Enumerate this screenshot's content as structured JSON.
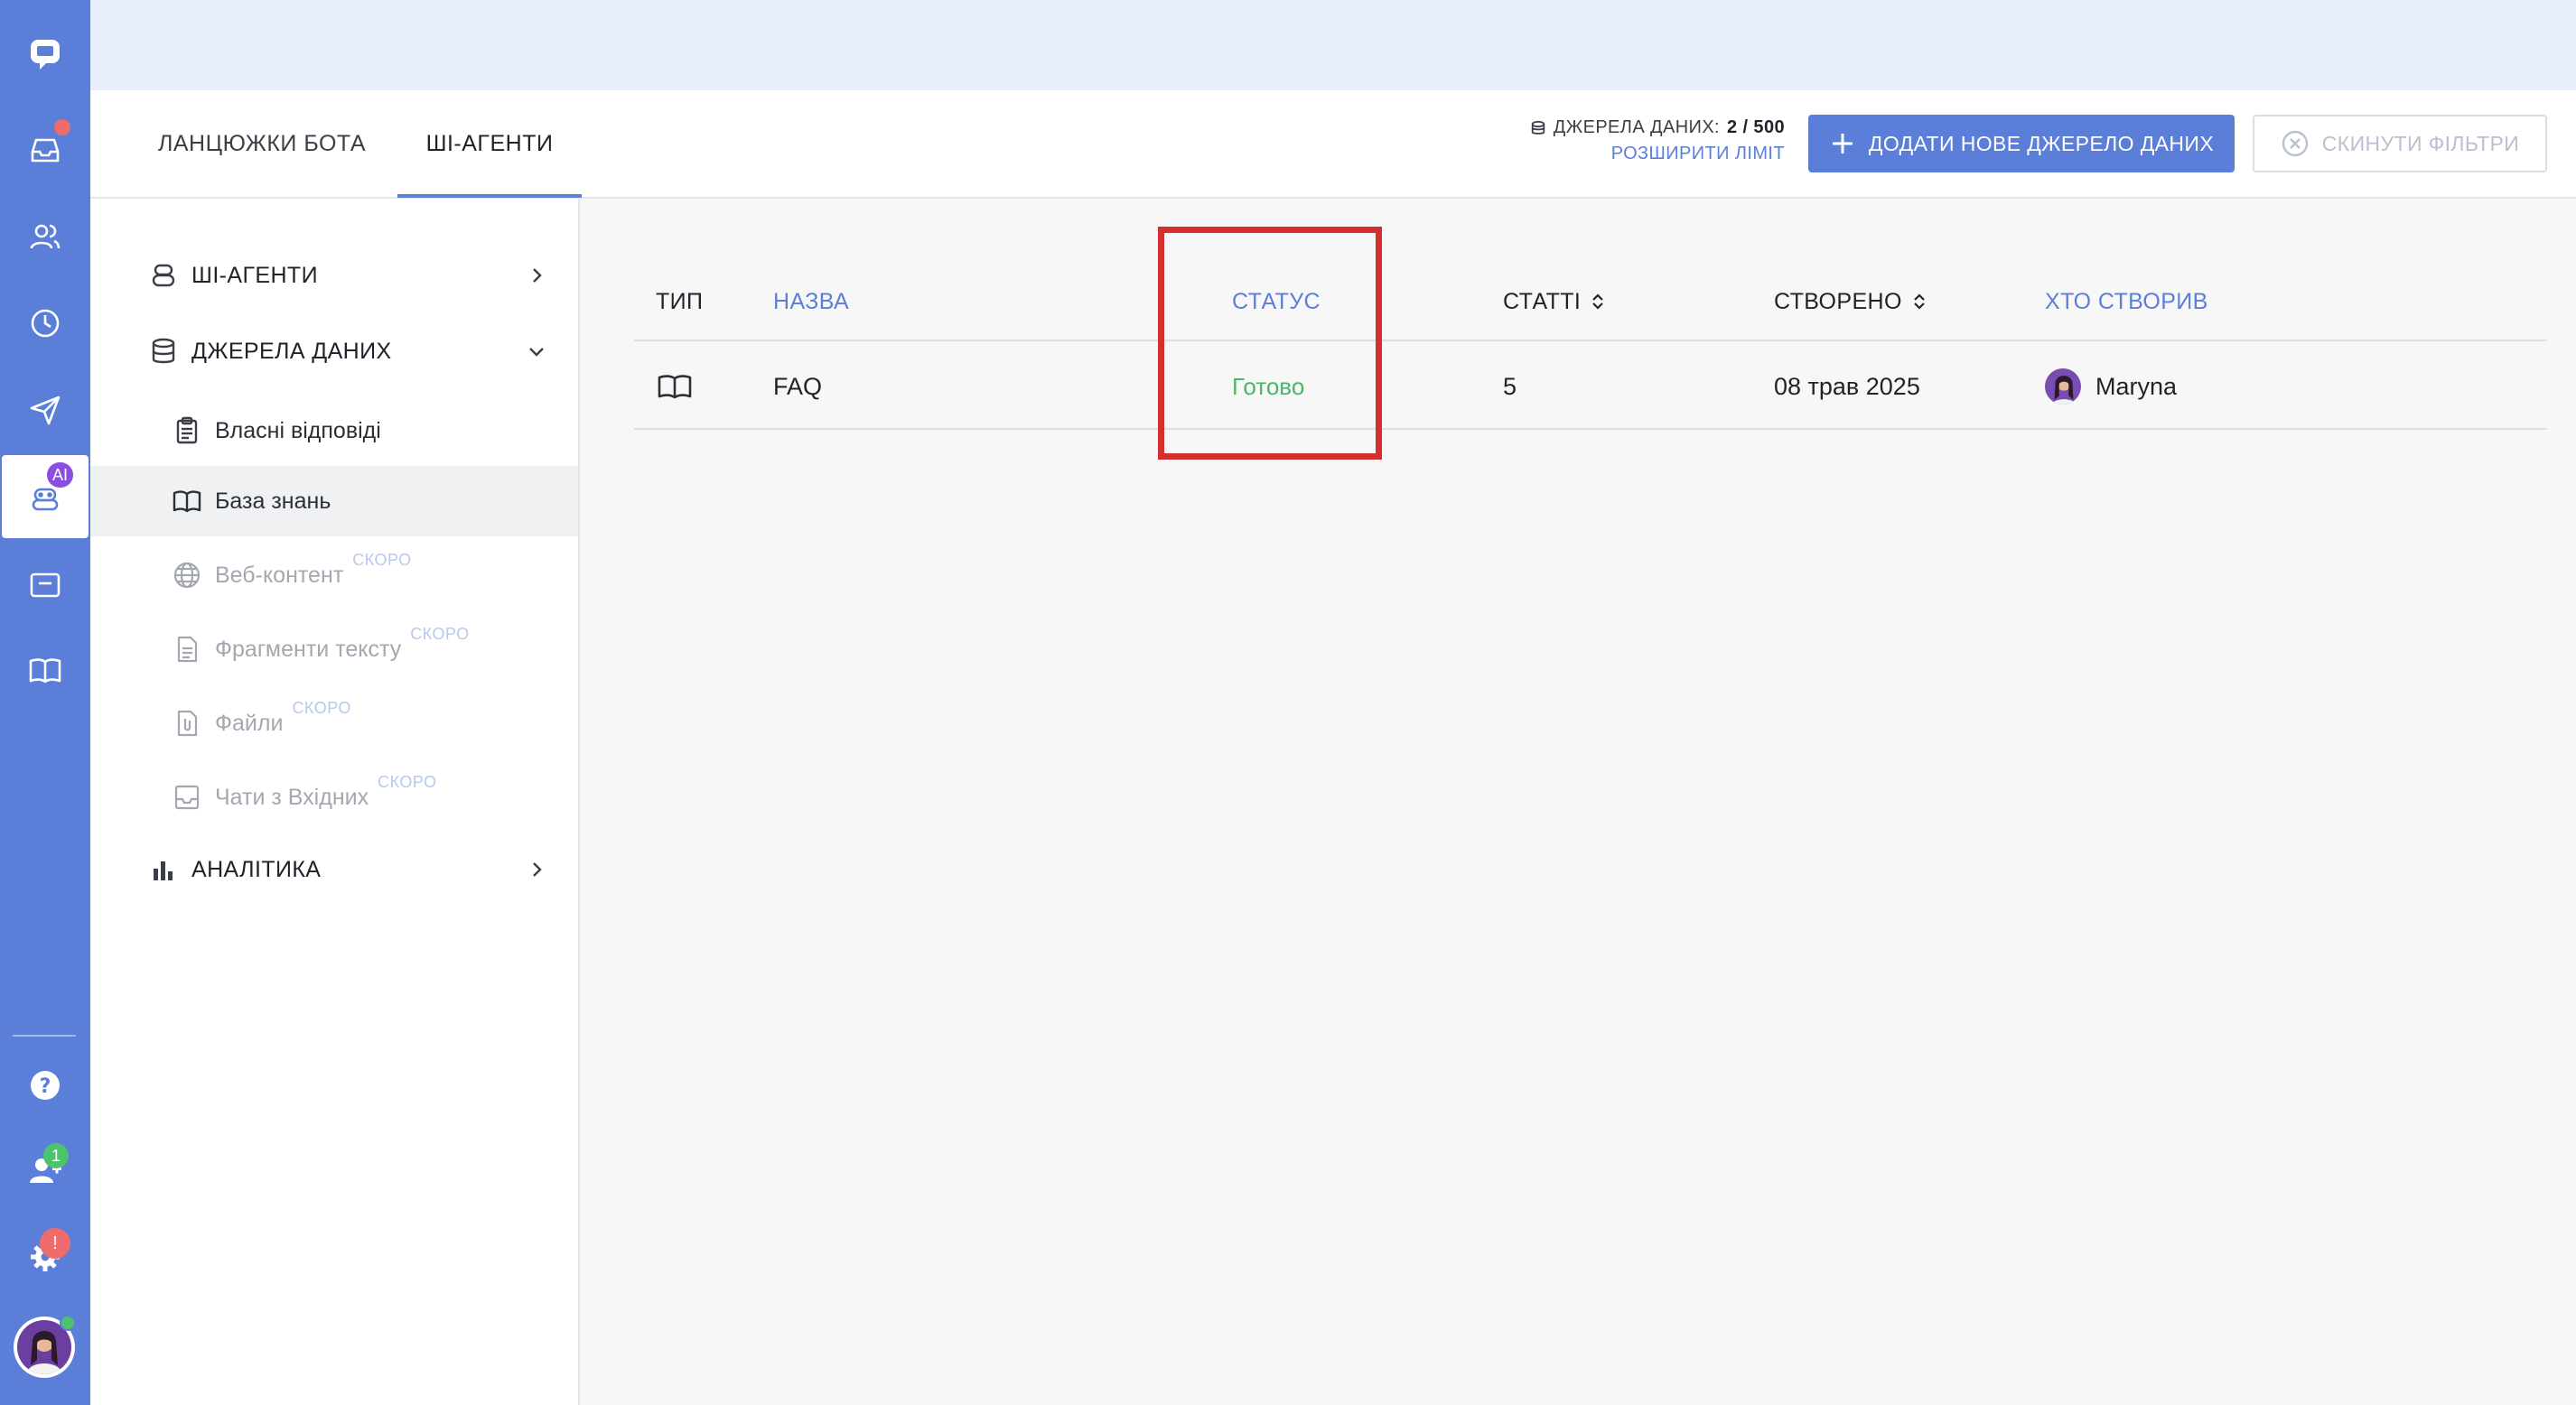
{
  "header": {
    "tabs": [
      {
        "label": "ЛАНЦЮЖКИ БОТА",
        "active": false
      },
      {
        "label": "ШІ-АГЕНТИ",
        "active": true
      }
    ],
    "quota": {
      "label": "ДЖЕРЕЛА ДАНИХ:",
      "value": "2 / 500",
      "link": "РОЗШИРИТИ ЛІМІТ"
    },
    "add_button": "ДОДАТИ НОВЕ ДЖЕРЕЛО ДАНИХ",
    "reset_button": "СКИНУТИ ФІЛЬТРИ"
  },
  "rail": {
    "items": [
      {
        "icon": "chat-logo-icon"
      },
      {
        "icon": "inbox-icon",
        "notification_dot": true
      },
      {
        "icon": "contacts-icon"
      },
      {
        "icon": "history-icon"
      },
      {
        "icon": "send-icon"
      },
      {
        "icon": "ai-bot-icon",
        "badge": "AI",
        "active": true
      },
      {
        "icon": "widget-icon"
      },
      {
        "icon": "knowledge-book-icon"
      },
      {
        "icon": "help-icon"
      },
      {
        "icon": "team-icon",
        "badge": "1"
      },
      {
        "icon": "settings-icon",
        "badge": "!"
      },
      {
        "icon": "user-avatar",
        "online": true
      }
    ]
  },
  "sidebar": {
    "sections": [
      {
        "label": "ШІ-АГЕНТИ",
        "icon": "ai-agent-icon",
        "expanded": false
      },
      {
        "label": "ДЖЕРЕЛА ДАНИХ",
        "icon": "database-icon",
        "expanded": true
      },
      {
        "label": "АНАЛІТИКА",
        "icon": "bar-chart-icon",
        "expanded": false
      }
    ],
    "items": [
      {
        "label": "Власні відповіді",
        "icon": "clipboard-icon",
        "selected": false,
        "disabled": false
      },
      {
        "label": "База знань",
        "icon": "book-icon",
        "selected": true,
        "disabled": false
      },
      {
        "label": "Веб-контент",
        "icon": "globe-icon",
        "disabled": true,
        "soon": "СКОРО"
      },
      {
        "label": "Фрагменти тексту",
        "icon": "document-icon",
        "disabled": true,
        "soon": "СКОРО"
      },
      {
        "label": "Файли",
        "icon": "file-clip-icon",
        "disabled": true,
        "soon": "СКОРО"
      },
      {
        "label": "Чати з Вхідних",
        "icon": "inbox-tray-icon",
        "disabled": true,
        "soon": "СКОРО"
      }
    ]
  },
  "table": {
    "columns": [
      {
        "label": "ТИП",
        "link": false,
        "sortable": false
      },
      {
        "label": "НАЗВА",
        "link": true,
        "sortable": false
      },
      {
        "label": "СТАТУС",
        "link": true,
        "sortable": false
      },
      {
        "label": "СТАТТІ",
        "link": false,
        "sortable": true
      },
      {
        "label": "СТВОРЕНО",
        "link": false,
        "sortable": true
      },
      {
        "label": "ХТО СТВОРИВ",
        "link": true,
        "sortable": false
      }
    ],
    "rows": [
      {
        "type_icon": "book-icon",
        "name": "FAQ",
        "status": "Готово",
        "articles": "5",
        "created": "08 трав 2025",
        "author": "Maryna"
      }
    ]
  },
  "colors": {
    "accent": "#5b7fd9",
    "status_ready": "#4cb56a",
    "highlight": "#d32f2f",
    "top_band": "#e8eefc"
  }
}
